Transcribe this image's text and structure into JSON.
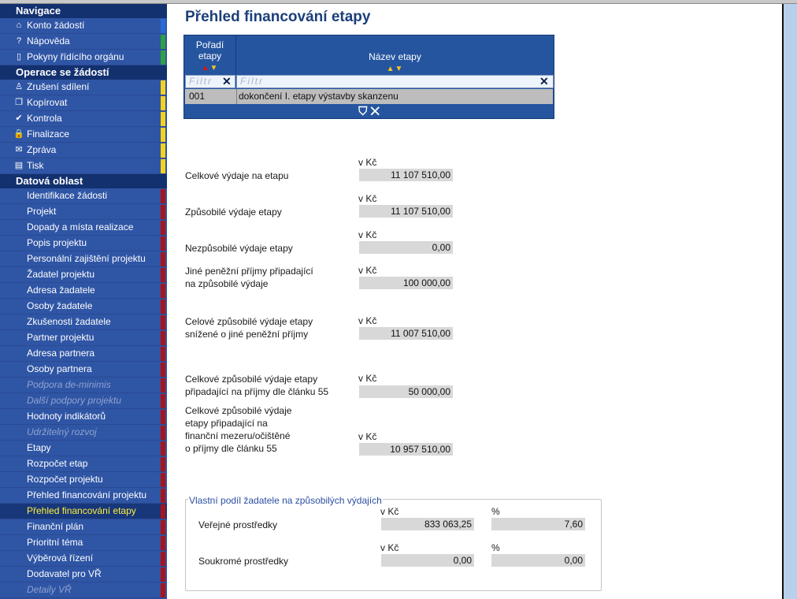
{
  "sidebar": {
    "navigace": {
      "title": "Navigace",
      "items": [
        {
          "label": "Konto žádostí",
          "icon": "⌂",
          "icon_name": "home-icon"
        },
        {
          "label": "Nápověda",
          "icon": "?",
          "icon_name": "help-icon"
        },
        {
          "label": "Pokyny řídícího orgánu",
          "icon": "▯",
          "icon_name": "book-icon"
        }
      ]
    },
    "operace": {
      "title": "Operace se žádostí",
      "items": [
        {
          "label": "Zrušení sdílení",
          "icon": "♙",
          "icon_name": "user-icon"
        },
        {
          "label": "Kopírovat",
          "icon": "❐",
          "icon_name": "copy-icon"
        },
        {
          "label": "Kontrola",
          "icon": "✔",
          "icon_name": "check-icon"
        },
        {
          "label": "Finalizace",
          "icon": "🔒",
          "icon_name": "lock-icon"
        },
        {
          "label": "Zpráva",
          "icon": "✉",
          "icon_name": "mail-icon"
        },
        {
          "label": "Tisk",
          "icon": "▤",
          "icon_name": "print-icon"
        }
      ]
    },
    "datova": {
      "title": "Datová oblast",
      "items": [
        {
          "label": "Identifikace žádosti"
        },
        {
          "label": "Projekt"
        },
        {
          "label": "Dopady a místa realizace"
        },
        {
          "label": "Popis projektu"
        },
        {
          "label": "Personální zajištění projektu"
        },
        {
          "label": "Žadatel projektu"
        },
        {
          "label": "Adresa žadatele"
        },
        {
          "label": "Osoby žadatele"
        },
        {
          "label": "Zkušenosti žadatele"
        },
        {
          "label": "Partner projektu"
        },
        {
          "label": "Adresa partnera"
        },
        {
          "label": "Osoby partnera"
        },
        {
          "label": "Podpora de-minimis",
          "disabled": true
        },
        {
          "label": "Další podpory projektu",
          "disabled": true
        },
        {
          "label": "Hodnoty indikátorů"
        },
        {
          "label": "Udržitelný rozvoj",
          "disabled": true
        },
        {
          "label": "Etapy"
        },
        {
          "label": "Rozpočet etap"
        },
        {
          "label": "Rozpočet projektu"
        },
        {
          "label": "Přehled financování projektu"
        },
        {
          "label": "Přehled financování etapy",
          "active": true
        },
        {
          "label": "Finanční plán"
        },
        {
          "label": "Prioritní téma"
        },
        {
          "label": "Výběrová řízení"
        },
        {
          "label": "Dodavatel pro VŘ"
        },
        {
          "label": "Detaily VŘ",
          "disabled": true
        }
      ]
    }
  },
  "page": {
    "title": "Přehled financování etapy"
  },
  "grid": {
    "col1_header": "Pořadí etapy",
    "col2_header": "Název etapy",
    "filter_placeholder": "Filtr",
    "rows": [
      {
        "poradi": "001",
        "nazev": "dokončení I. etapy výstavby skanzenu"
      }
    ]
  },
  "fields": [
    {
      "label": "Celkové výdaje na etapu",
      "unit": "v Kč",
      "value": "11 107 510,00"
    },
    {
      "label": "Způsobilé výdaje etapy",
      "unit": "v Kč",
      "value": "11 107 510,00"
    },
    {
      "label": "Nezpůsobilé výdaje etapy",
      "unit": "v Kč",
      "value": "0,00"
    },
    {
      "label": "Jiné peněžní příjmy připadající\nna způsobilé výdaje",
      "unit": "v Kč",
      "value": "100 000,00"
    },
    {
      "label": "Celové způsobilé výdaje etapy\nsnížené o jiné peněžní příjmy",
      "unit": "v Kč",
      "value": "11 007 510,00"
    },
    {
      "label": "Celkové způsobilé výdaje etapy\npřipadající na příjmy dle článku 55",
      "unit": "v Kč",
      "value": "50 000,00"
    },
    {
      "label": "Celkové způsobilé výdaje\netapy připadající na\nfinanční mezeru/očištěné\no příjmy dle článku 55",
      "unit": "v Kč",
      "value": "10 957 510,00"
    }
  ],
  "vlastni_podil": {
    "legend": "Vlastní podíl žadatele na způsobilých výdajích",
    "rows": [
      {
        "label": "Veřejné prostředky",
        "unit_czk": "v Kč",
        "value_czk": "833 063,25",
        "unit_pct": "%",
        "value_pct": "7,60"
      },
      {
        "label": "Soukromé prostředky",
        "unit_czk": "v Kč",
        "value_czk": "0,00",
        "unit_pct": "%",
        "value_pct": "0,00"
      }
    ]
  }
}
